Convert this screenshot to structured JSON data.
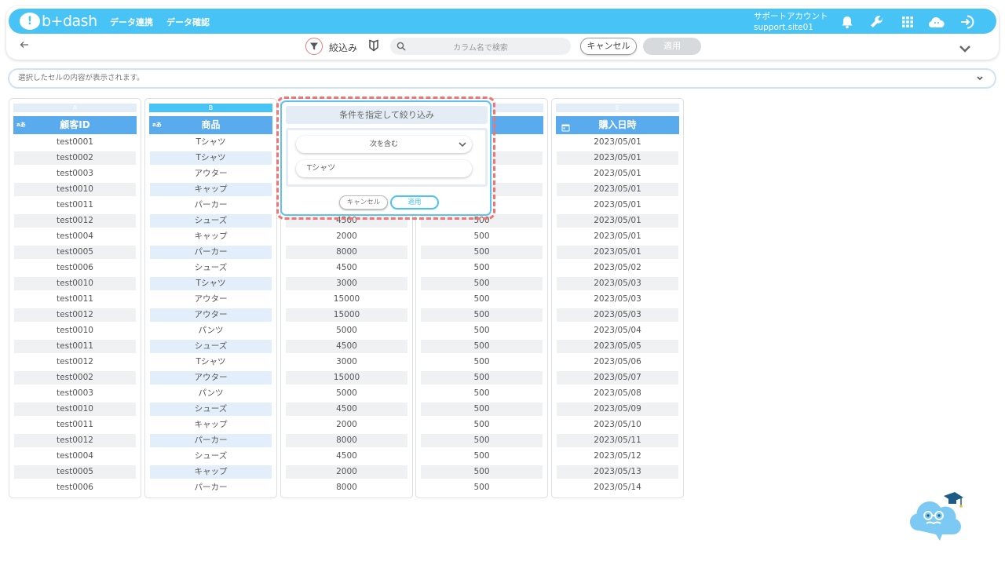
{
  "navbar": {
    "logo_text": "b+dash",
    "logo_mark": "!",
    "links": [
      "データ連携",
      "データ確認"
    ],
    "account_name": "サポートアカウント",
    "account_id": "support.site01"
  },
  "toolbar": {
    "filter_label": "絞込み",
    "search_placeholder": "カラム名で検索",
    "cancel_label": "キャンセル",
    "apply_label": "適用"
  },
  "cellbar": {
    "placeholder": "選択したセルの内容が表示されます。"
  },
  "columns": [
    {
      "letter": "A",
      "header": "顧客ID",
      "type_label": "aあ",
      "cells": [
        "test0001",
        "test0002",
        "test0003",
        "test0010",
        "test0011",
        "test0012",
        "test0004",
        "test0005",
        "test0006",
        "test0010",
        "test0011",
        "test0012",
        "test0010",
        "test0011",
        "test0012",
        "test0002",
        "test0003",
        "test0010",
        "test0011",
        "test0012",
        "test0004",
        "test0005",
        "test0006"
      ]
    },
    {
      "letter": "B",
      "header": "商品",
      "type_label": "aあ",
      "cells": [
        "Tシャツ",
        "Tシャツ",
        "アウター",
        "キャップ",
        "パーカー",
        "シューズ",
        "キャップ",
        "パーカー",
        "シューズ",
        "Tシャツ",
        "アウター",
        "アウター",
        "パンツ",
        "シューズ",
        "Tシャツ",
        "アウター",
        "パンツ",
        "シューズ",
        "キャップ",
        "パーカー",
        "シューズ",
        "キャップ",
        "パーカー"
      ]
    },
    {
      "letter": "",
      "header": "",
      "cells": [
        "",
        "",
        "",
        "",
        "",
        "4500",
        "2000",
        "8000",
        "4500",
        "3000",
        "15000",
        "15000",
        "5000",
        "4500",
        "3000",
        "15000",
        "5000",
        "4500",
        "2000",
        "8000",
        "4500",
        "2000",
        "8000"
      ]
    },
    {
      "letter": "",
      "header": "",
      "cells": [
        "",
        "",
        "",
        "",
        "",
        "500",
        "500",
        "500",
        "500",
        "500",
        "500",
        "500",
        "500",
        "500",
        "500",
        "500",
        "500",
        "500",
        "500",
        "500",
        "500",
        "500",
        "500"
      ]
    },
    {
      "letter": "E",
      "header": "購入日時",
      "cells": [
        "2023/05/01",
        "2023/05/01",
        "2023/05/01",
        "2023/05/01",
        "2023/05/01",
        "2023/05/01",
        "2023/05/01",
        "2023/05/01",
        "2023/05/02",
        "2023/05/03",
        "2023/05/03",
        "2023/05/03",
        "2023/05/04",
        "2023/05/05",
        "2023/05/06",
        "2023/05/07",
        "2023/05/08",
        "2023/05/09",
        "2023/05/10",
        "2023/05/11",
        "2023/05/12",
        "2023/05/13",
        "2023/05/14"
      ]
    }
  ],
  "popup": {
    "title": "条件を指定して絞り込み",
    "condition_selected": "次を含む",
    "value": "Tシャツ",
    "cancel_label": "キャンセル",
    "apply_label": "適用"
  },
  "colors": {
    "brand": "#47c3f5",
    "header_blue": "#5aabee",
    "highlight_red": "#f07474"
  }
}
